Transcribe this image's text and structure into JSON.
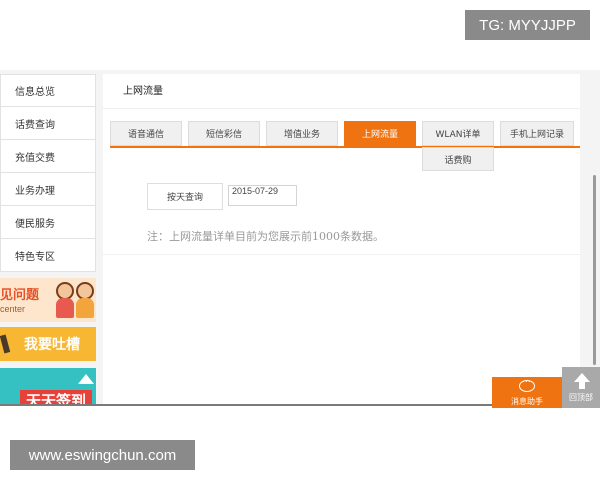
{
  "badge": {
    "text": "TG: MYYJJPP"
  },
  "watermark": {
    "text": "www.eswingchun.com"
  },
  "sidebar": {
    "items": [
      {
        "label": "信息总览"
      },
      {
        "label": "话费查询"
      },
      {
        "label": "充值交费"
      },
      {
        "label": "业务办理"
      },
      {
        "label": "便民服务"
      },
      {
        "label": "特色专区"
      }
    ]
  },
  "promos": {
    "faq": {
      "title": "见问题",
      "sub": "center"
    },
    "complain": {
      "title": "我要吐槽"
    },
    "signin": {
      "title": "天天签到"
    }
  },
  "content": {
    "title": "上网流量",
    "tabs": [
      {
        "label": "语音通信"
      },
      {
        "label": "短信彩信"
      },
      {
        "label": "增值业务"
      },
      {
        "label": "上网流量"
      },
      {
        "label": "WLAN详单"
      },
      {
        "label": "手机上网记录"
      }
    ],
    "dropdown_item": "话费购",
    "query_button": "按天查询",
    "date_value": "2015-07-29",
    "note": "注：上网流量详单目前为您展示前1000条数据。"
  },
  "floating": {
    "helper_label": "消息助手",
    "top_label": "回顶部"
  },
  "colors": {
    "accent": "#f07312",
    "badge_bg": "#8a8a8a"
  }
}
